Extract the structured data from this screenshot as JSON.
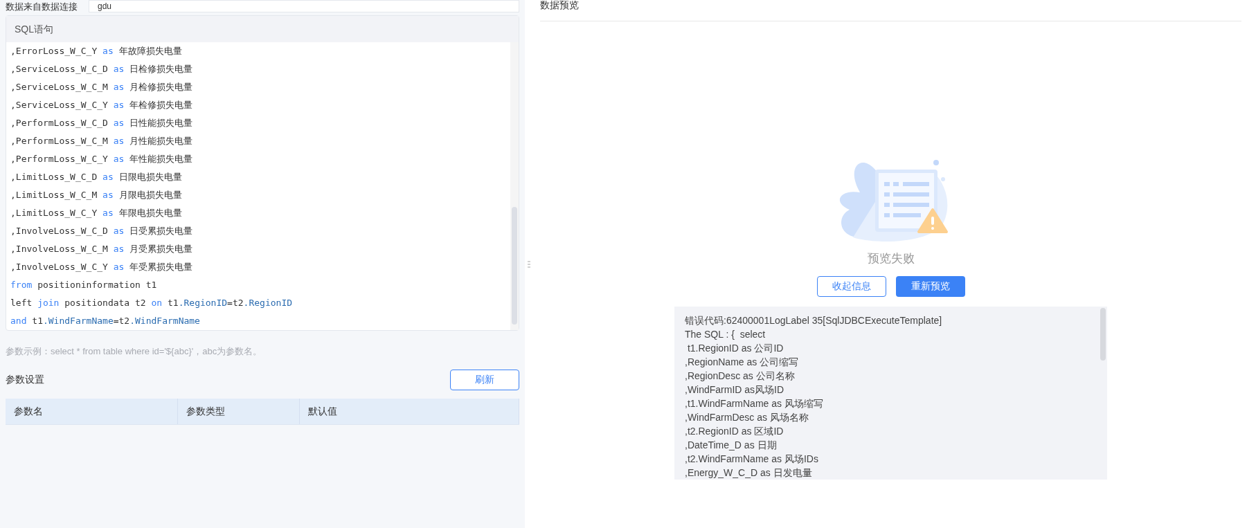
{
  "source": {
    "label": "数据来自数据连接",
    "value": "gdu"
  },
  "sql": {
    "title": "SQL语句",
    "lines": [
      [
        {
          "kind": "text",
          "text": ",ErrorLoss_W_C_Y "
        },
        {
          "kind": "keyword",
          "text": "as"
        },
        {
          "kind": "text",
          "text": " 年故障损失电量"
        }
      ],
      [
        {
          "kind": "text",
          "text": ",ServiceLoss_W_C_D "
        },
        {
          "kind": "keyword",
          "text": "as"
        },
        {
          "kind": "text",
          "text": " 日检修损失电量"
        }
      ],
      [
        {
          "kind": "text",
          "text": ",ServiceLoss_W_C_M "
        },
        {
          "kind": "keyword",
          "text": "as"
        },
        {
          "kind": "text",
          "text": " 月检修损失电量"
        }
      ],
      [
        {
          "kind": "text",
          "text": ",ServiceLoss_W_C_Y "
        },
        {
          "kind": "keyword",
          "text": "as"
        },
        {
          "kind": "text",
          "text": " 年检修损失电量"
        }
      ],
      [
        {
          "kind": "text",
          "text": ",PerformLoss_W_C_D "
        },
        {
          "kind": "keyword",
          "text": "as"
        },
        {
          "kind": "text",
          "text": " 日性能损失电量"
        }
      ],
      [
        {
          "kind": "text",
          "text": ",PerformLoss_W_C_M "
        },
        {
          "kind": "keyword",
          "text": "as"
        },
        {
          "kind": "text",
          "text": " 月性能损失电量"
        }
      ],
      [
        {
          "kind": "text",
          "text": ",PerformLoss_W_C_Y "
        },
        {
          "kind": "keyword",
          "text": "as"
        },
        {
          "kind": "text",
          "text": " 年性能损失电量"
        }
      ],
      [
        {
          "kind": "text",
          "text": ",LimitLoss_W_C_D "
        },
        {
          "kind": "keyword",
          "text": "as"
        },
        {
          "kind": "text",
          "text": " 日限电损失电量"
        }
      ],
      [
        {
          "kind": "text",
          "text": ",LimitLoss_W_C_M "
        },
        {
          "kind": "keyword",
          "text": "as"
        },
        {
          "kind": "text",
          "text": " 月限电损失电量"
        }
      ],
      [
        {
          "kind": "text",
          "text": ",LimitLoss_W_C_Y "
        },
        {
          "kind": "keyword",
          "text": "as"
        },
        {
          "kind": "text",
          "text": " 年限电损失电量"
        }
      ],
      [
        {
          "kind": "text",
          "text": ",InvolveLoss_W_C_D "
        },
        {
          "kind": "keyword",
          "text": "as"
        },
        {
          "kind": "text",
          "text": " 日受累损失电量"
        }
      ],
      [
        {
          "kind": "text",
          "text": ",InvolveLoss_W_C_M "
        },
        {
          "kind": "keyword",
          "text": "as"
        },
        {
          "kind": "text",
          "text": " 月受累损失电量"
        }
      ],
      [
        {
          "kind": "text",
          "text": ",InvolveLoss_W_C_Y "
        },
        {
          "kind": "keyword",
          "text": "as"
        },
        {
          "kind": "text",
          "text": " 年受累损失电量"
        }
      ],
      [
        {
          "kind": "keyword",
          "text": "from"
        },
        {
          "kind": "text",
          "text": " positioninformation t1"
        }
      ],
      [
        {
          "kind": "text",
          "text": "left "
        },
        {
          "kind": "keyword",
          "text": "join"
        },
        {
          "kind": "text",
          "text": " positiondata t2 "
        },
        {
          "kind": "keyword",
          "text": "on"
        },
        {
          "kind": "text",
          "text": " t1"
        },
        {
          "kind": "property",
          "text": ".RegionID"
        },
        {
          "kind": "text",
          "text": "=t2"
        },
        {
          "kind": "property",
          "text": ".RegionID"
        }
      ],
      [
        {
          "kind": "keyword",
          "text": "and"
        },
        {
          "kind": "text",
          "text": " t1"
        },
        {
          "kind": "property",
          "text": ".WindFarmName"
        },
        {
          "kind": "text",
          "text": "=t2"
        },
        {
          "kind": "property",
          "text": ".WindFarmName"
        }
      ]
    ]
  },
  "hint": "参数示例：select * from table where id='${abc}'，abc为参数名。",
  "params": {
    "title": "参数设置",
    "refresh_button": "刷新",
    "columns": [
      "参数名",
      "参数类型",
      "默认值"
    ]
  },
  "preview": {
    "title": "数据预览",
    "status": "预览失败",
    "collapse_button": "收起信息",
    "retry_button": "重新预览",
    "error_lines": [
      "错误代码:62400001LogLabel 35[SqlJDBCExecuteTemplate]",
      "The SQL : {  select",
      " t1.RegionID as 公司ID",
      ",RegionName as 公司缩写",
      ",RegionDesc as 公司名称",
      ",WindFarmID as风场ID",
      ",t1.WindFarmName as 风场缩写",
      ",WindFarmDesc as 风场名称",
      ",t2.RegionID as 区域ID",
      ",DateTime_D as 日期",
      ",t2.WindFarmName as 风场IDs",
      ",Energy_W_C_D as 日发电量"
    ]
  }
}
